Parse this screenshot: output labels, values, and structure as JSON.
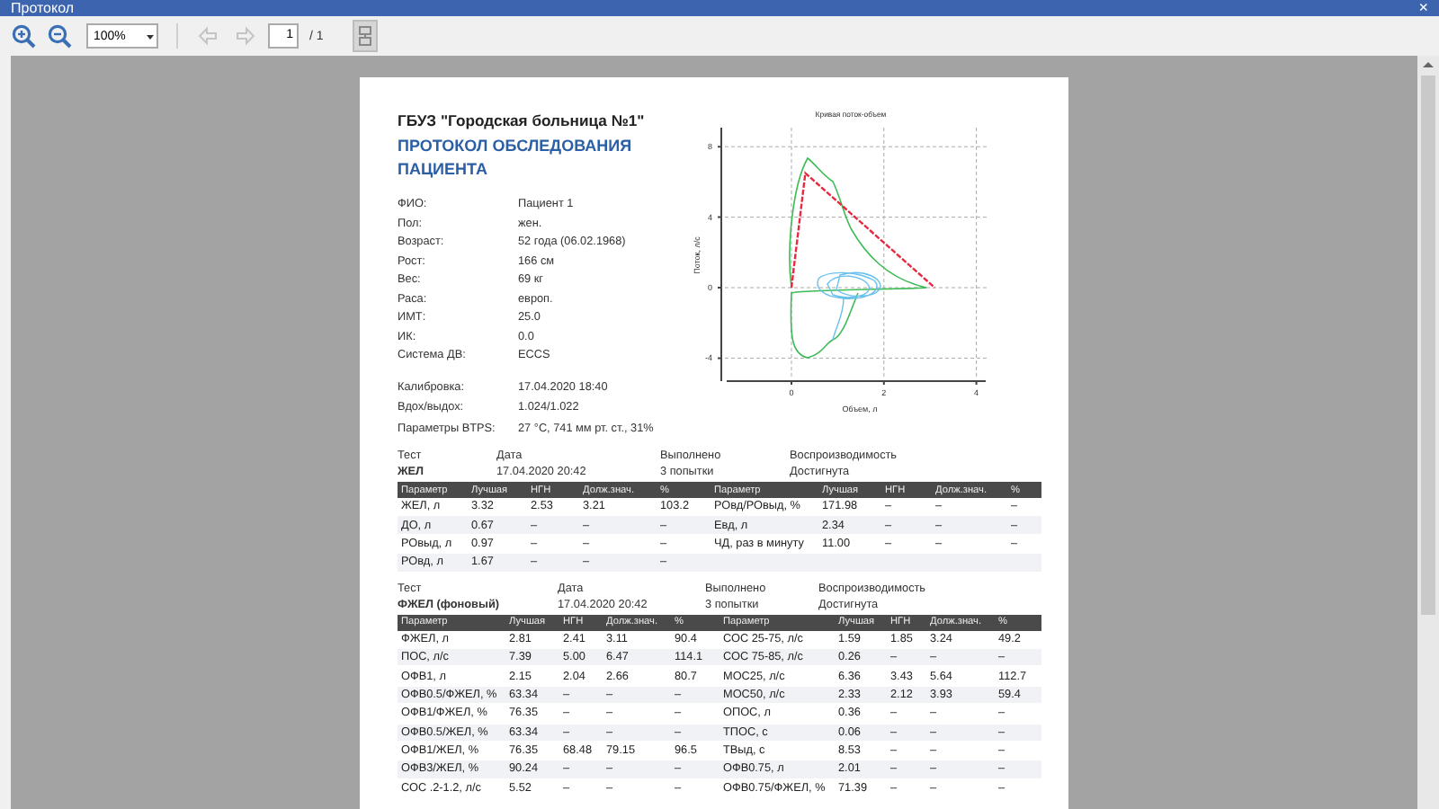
{
  "window": {
    "title": "Протокол",
    "close": "×"
  },
  "toolbar": {
    "zoom": "100%",
    "back": {
      "disabled": true
    },
    "forward": {
      "disabled": true
    },
    "page": "1",
    "page_count": "/ 1"
  },
  "report": {
    "organization": "ГБУЗ \"Городская больница №1\"",
    "heading": "ПРОТОКОЛ ОБСЛЕДОВАНИЯ ПАЦИЕНТА",
    "patient": [
      {
        "label": "ФИО:",
        "value": "Пациент 1"
      },
      {
        "label": "Пол:",
        "value": "жен."
      },
      {
        "label": "Возраст:",
        "value": "52 года (06.02.1968)"
      },
      {
        "label": "Рост:",
        "value": "166 см"
      },
      {
        "label": "Вес:",
        "value": "69 кг"
      },
      {
        "label": "Раса:",
        "value": "европ."
      },
      {
        "label": "ИМТ:",
        "value": "25.0"
      },
      {
        "label": "ИК:",
        "value": "0.0"
      },
      {
        "label": "Система ДВ:",
        "value": "ECCS"
      }
    ],
    "session": [
      {
        "label": "Калибровка:",
        "value": "17.04.2020 18:40"
      },
      {
        "label": "Вдох/выдох:",
        "value": "1.024/1.022"
      },
      {
        "label": "Параметры BTPS:",
        "value": "27 °C, 741 мм рт. ст., 31%"
      }
    ],
    "plot": {
      "title": "Кривая поток-объем",
      "xlabel": "Объем, л",
      "ylabel": "Поток, л/с",
      "xticks": [
        "0",
        "2",
        "4"
      ],
      "yticks": [
        "8",
        "4",
        "0",
        "-4"
      ]
    },
    "tests": [
      {
        "info": [
          {
            "label": "Тест",
            "value": "ЖЕЛ"
          },
          {
            "label": "Дата",
            "value": "17.04.2020 20:42"
          },
          {
            "label": "Выполнено",
            "value": "3 попытки"
          },
          {
            "label": "Воспроизводимость",
            "value": "Достигнута"
          }
        ],
        "columns": [
          "Параметр",
          "Лучшая",
          "НГН",
          "Долж.знач.",
          "%",
          "Параметр",
          "Лучшая",
          "НГН",
          "Долж.знач.",
          "%"
        ],
        "rows": [
          [
            "ЖЕЛ, л",
            "3.32",
            "2.53",
            "3.21",
            "103.2",
            "РОвд/РОвыд, %",
            "171.98",
            "–",
            "–",
            "–"
          ],
          [
            "ДО, л",
            "0.67",
            "–",
            "–",
            "–",
            "Евд, л",
            "2.34",
            "–",
            "–",
            "–"
          ],
          [
            "РОвыд, л",
            "0.97",
            "–",
            "–",
            "–",
            "ЧД, раз в минуту",
            "11.00",
            "–",
            "–",
            "–"
          ],
          [
            "РОвд, л",
            "1.67",
            "–",
            "–",
            "–"
          ]
        ]
      },
      {
        "info": [
          {
            "label": "Тест",
            "value": "ФЖЕЛ (фоновый)"
          },
          {
            "label": "Дата",
            "value": "17.04.2020 20:42"
          },
          {
            "label": "Выполнено",
            "value": "3 попытки"
          },
          {
            "label": "Воспроизводимость",
            "value": "Достигнута"
          }
        ],
        "columns": [
          "Параметр",
          "Лучшая",
          "НГН",
          "Долж.знач.",
          "%",
          "Параметр",
          "Лучшая",
          "НГН",
          "Долж.знач.",
          "%"
        ],
        "rows": [
          [
            "ФЖЕЛ, л",
            "2.81",
            "2.41",
            "3.11",
            "90.4",
            "СОС 25-75, л/с",
            "1.59",
            "1.85",
            "3.24",
            "49.2"
          ],
          [
            "ПОС, л/с",
            "7.39",
            "5.00",
            "6.47",
            "114.1",
            "СОС 75-85, л/с",
            "0.26",
            "–",
            "–",
            "–"
          ],
          [
            "ОФВ1, л",
            "2.15",
            "2.04",
            "2.66",
            "80.7",
            "МОС25, л/с",
            "6.36",
            "3.43",
            "5.64",
            "112.7"
          ],
          [
            "ОФВ0.5/ФЖЕЛ, %",
            "63.34",
            "–",
            "–",
            "–",
            "МОС50, л/с",
            "2.33",
            "2.12",
            "3.93",
            "59.4"
          ],
          [
            "ОФВ1/ФЖЕЛ, %",
            "76.35",
            "–",
            "–",
            "–",
            "ОПОС, л",
            "0.36",
            "–",
            "–",
            "–"
          ],
          [
            "ОФВ0.5/ЖЕЛ, %",
            "63.34",
            "–",
            "–",
            "–",
            "ТПОС, с",
            "0.06",
            "–",
            "–",
            "–"
          ],
          [
            "ОФВ1/ЖЕЛ, %",
            "76.35",
            "68.48",
            "79.15",
            "96.5",
            "ТВыд, с",
            "8.53",
            "–",
            "–",
            "–"
          ],
          [
            "ОФВ3/ЖЕЛ, %",
            "90.24",
            "–",
            "–",
            "–",
            "ОФВ0.75, л",
            "2.01",
            "–",
            "–",
            "–"
          ],
          [
            "СОС .2-1.2, л/с",
            "5.52",
            "–",
            "–",
            "–",
            "ОФВ0.75/ФЖЕЛ, %",
            "71.39",
            "–",
            "–",
            "–"
          ]
        ]
      }
    ]
  }
}
